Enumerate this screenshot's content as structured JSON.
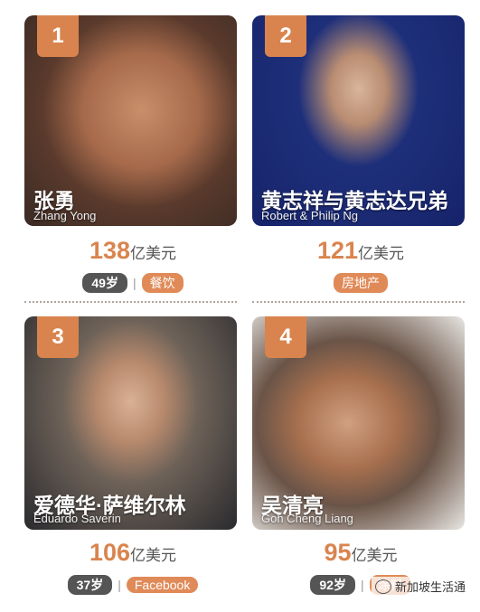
{
  "cards": [
    {
      "rank": "1",
      "name_cn": "张勇",
      "name_en": "Zhang Yong",
      "worth_value": "138",
      "worth_unit": "亿美元",
      "age": "49岁",
      "industry": "餐饮"
    },
    {
      "rank": "2",
      "name_cn": "黄志祥与黄志达兄弟",
      "name_en": "Robert & Philip Ng",
      "worth_value": "121",
      "worth_unit": "亿美元",
      "age": "",
      "industry": "房地产"
    },
    {
      "rank": "3",
      "name_cn": "爱德华·萨维尔林",
      "name_en": "Eduardo Saverin",
      "worth_value": "106",
      "worth_unit": "亿美元",
      "age": "37岁",
      "industry": "Facebook"
    },
    {
      "rank": "4",
      "name_cn": "吴清亮",
      "name_en": "Goh Cheng Liang",
      "worth_value": "95",
      "worth_unit": "亿美元",
      "age": "92岁",
      "industry": "涂料"
    }
  ],
  "watermark": {
    "text": "新加坡生活通",
    "icon": "wechat-icon"
  },
  "colors": {
    "accent": "#d9844e",
    "age_badge": "#555555"
  }
}
